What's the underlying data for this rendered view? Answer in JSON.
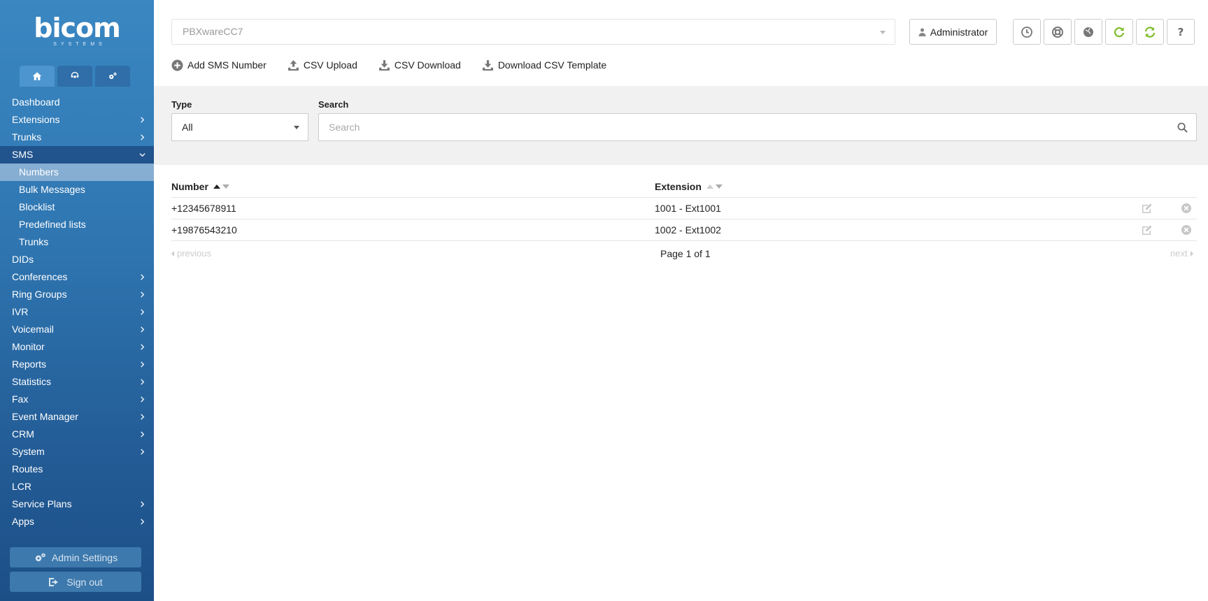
{
  "brand": {
    "logo_text": "bicom",
    "logo_sub": "SYSTEMS"
  },
  "sidebar": {
    "tabs": [
      {
        "icon": "home-icon"
      },
      {
        "icon": "support-agent-icon"
      },
      {
        "icon": "gears-icon"
      }
    ],
    "items": [
      {
        "label": "Dashboard",
        "has_children": false
      },
      {
        "label": "Extensions",
        "has_children": true
      },
      {
        "label": "Trunks",
        "has_children": true
      },
      {
        "label": "SMS",
        "has_children": true,
        "open": true,
        "children": [
          "Numbers",
          "Bulk Messages",
          "Blocklist",
          "Predefined lists",
          "Trunks"
        ]
      },
      {
        "label": "DIDs",
        "has_children": false
      },
      {
        "label": "Conferences",
        "has_children": true
      },
      {
        "label": "Ring Groups",
        "has_children": true
      },
      {
        "label": "IVR",
        "has_children": true
      },
      {
        "label": "Voicemail",
        "has_children": true
      },
      {
        "label": "Monitor",
        "has_children": true
      },
      {
        "label": "Reports",
        "has_children": true
      },
      {
        "label": "Statistics",
        "has_children": true
      },
      {
        "label": "Fax",
        "has_children": true
      },
      {
        "label": "Event Manager",
        "has_children": true
      },
      {
        "label": "CRM",
        "has_children": true
      },
      {
        "label": "System",
        "has_children": true
      },
      {
        "label": "Routes",
        "has_children": false
      },
      {
        "label": "LCR",
        "has_children": false
      },
      {
        "label": "Service Plans",
        "has_children": true
      },
      {
        "label": "Apps",
        "has_children": true
      }
    ],
    "active_child": "Numbers",
    "admin_settings_label": "Admin Settings",
    "sign_out_label": "Sign out"
  },
  "topbar": {
    "server_select_value": "PBXwareCC7",
    "user_label": "Administrator",
    "icon_buttons": [
      "clock-icon",
      "lifebuoy-icon",
      "globe-icon",
      "refresh-icon",
      "sync-icon",
      "help-icon"
    ]
  },
  "actions": {
    "add": "Add SMS Number",
    "upload": "CSV Upload",
    "download": "CSV Download",
    "template": "Download CSV Template"
  },
  "filters": {
    "type_label": "Type",
    "type_value": "All",
    "search_label": "Search",
    "search_placeholder": "Search"
  },
  "table": {
    "columns": {
      "number": "Number",
      "extension": "Extension"
    },
    "rows": [
      {
        "number": "+12345678911",
        "extension": "1001 - Ext1001"
      },
      {
        "number": "+19876543210",
        "extension": "1002 - Ext1002"
      }
    ]
  },
  "pagination": {
    "previous": "previous",
    "info": "Page 1 of 1",
    "next": "next"
  },
  "colors": {
    "sidebar_top": "#3a87c2",
    "sidebar_bottom": "#1c4f86",
    "accent_green": "#7dbd2a"
  }
}
